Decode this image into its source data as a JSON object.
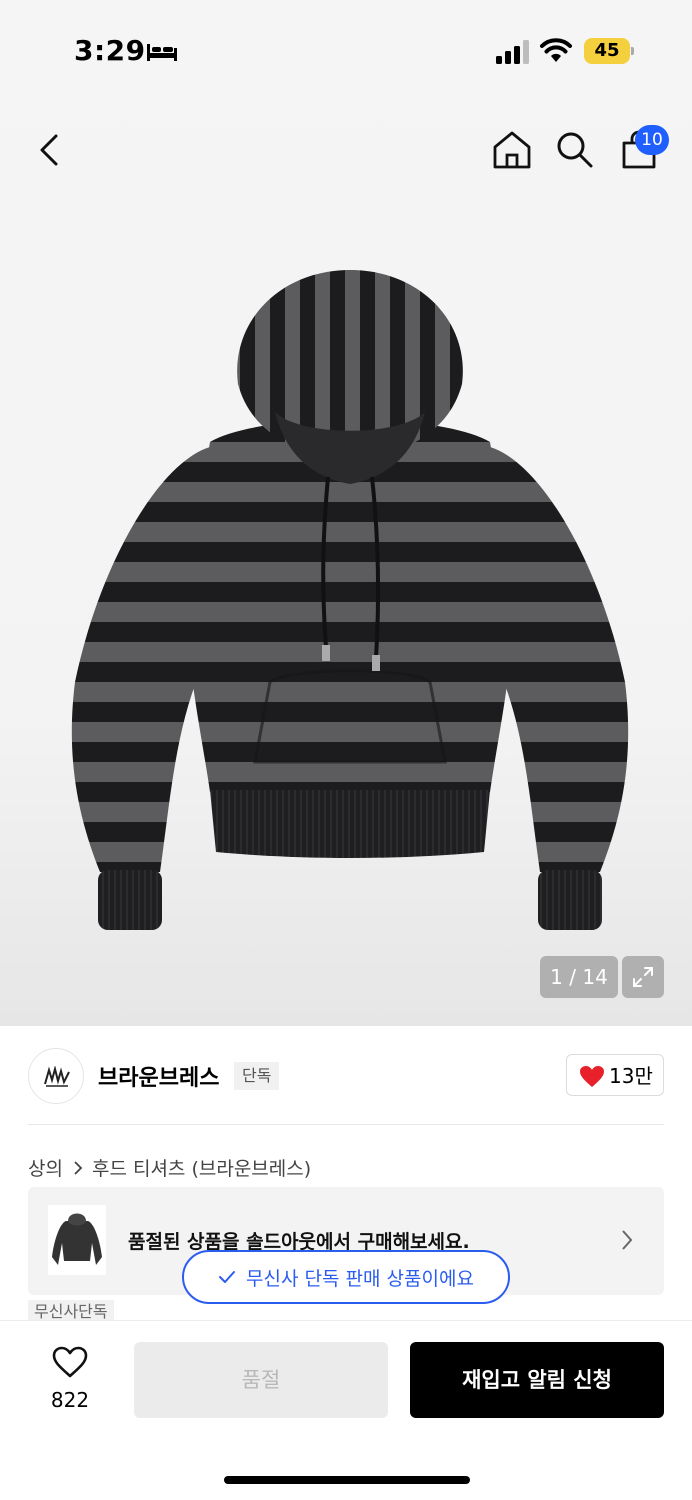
{
  "status_bar": {
    "time": "3:29",
    "battery": "45",
    "icons": [
      "bed-icon",
      "signal-icon",
      "wifi-icon",
      "battery-icon"
    ],
    "battery_color": "#f4d03f"
  },
  "nav": {
    "icons": [
      "back-icon",
      "home-icon",
      "search-icon",
      "cart-icon"
    ],
    "cart_badge": "10",
    "badge_color": "#1f5eff"
  },
  "gallery": {
    "counter": "1 / 14",
    "expand_icon": "expand-icon",
    "stripe_colors": [
      "#1c1c1e",
      "#5c5c5e"
    ]
  },
  "brand": {
    "name": "브라운브레스",
    "tag": "단독",
    "likes": "13만",
    "heart_color": "#e8202a"
  },
  "breadcrumb": {
    "category": "상의",
    "subcategory": "후드 티셔츠 (브라운브레스)"
  },
  "soldout_banner": {
    "text": "품절된 상품을 솔드아웃에서 구매해보세요."
  },
  "exclusive": {
    "pill_text": "무신사 단독 판매 상품이에요",
    "tag": "무신사단독",
    "accent_color": "#2b5cf0"
  },
  "bottom_bar": {
    "wish_count": "822",
    "soldout_label": "품절",
    "restock_label": "재입고 알림 신청"
  }
}
